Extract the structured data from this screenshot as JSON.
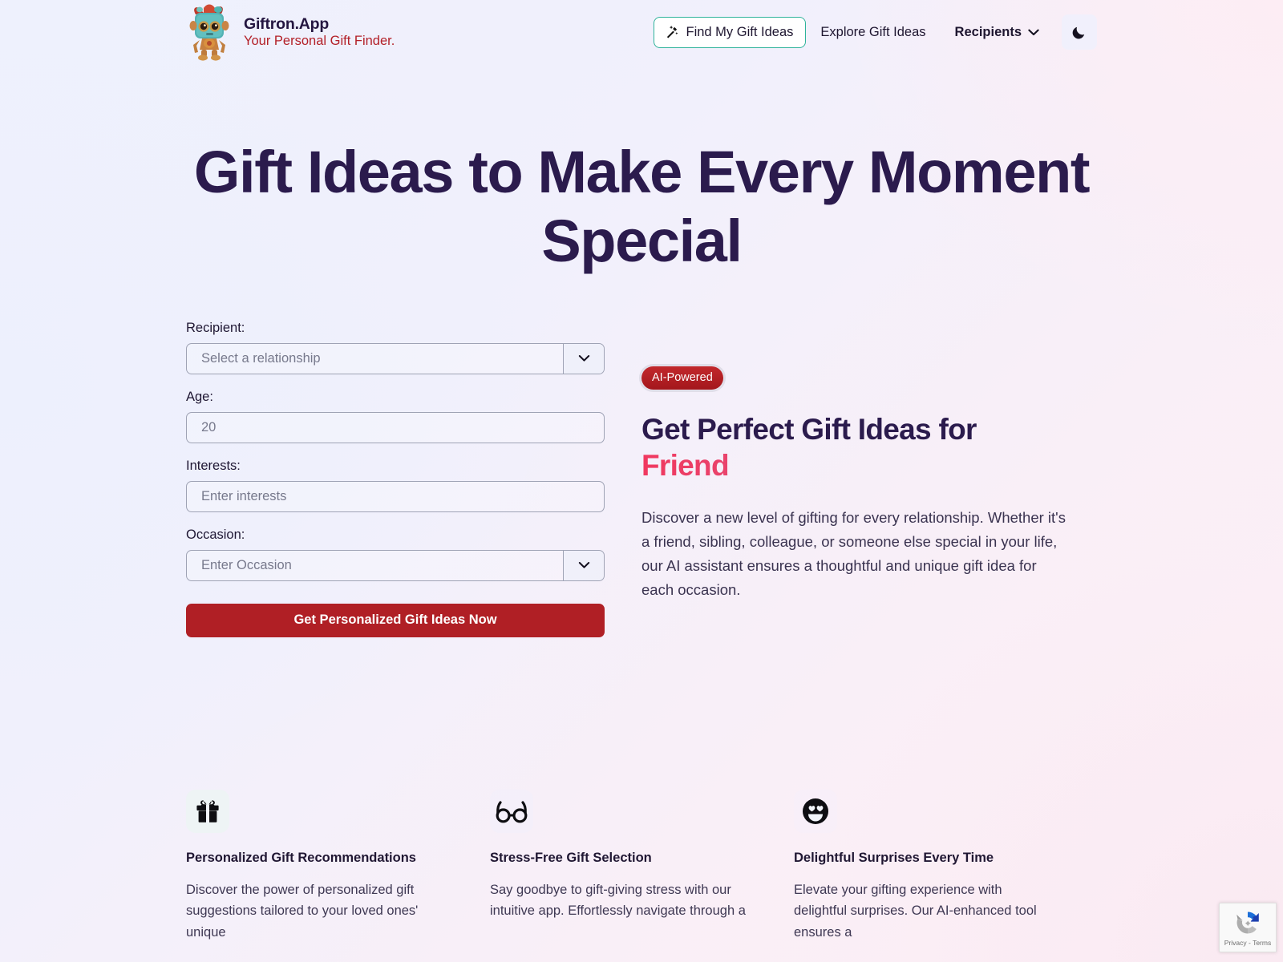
{
  "brand": {
    "logo_icon": "robot-gift-logo",
    "name": "Giftron.App",
    "tagline": "Your Personal Gift Finder."
  },
  "nav": {
    "cta": {
      "label": "Find My Gift Ideas",
      "icon": "magic-wand-icon",
      "border_color": "#2FB39B"
    },
    "links": [
      {
        "label": "Explore Gift Ideas"
      }
    ],
    "dropdown": {
      "label": "Recipients",
      "icon": "chevron-down-icon"
    },
    "theme_toggle": {
      "icon": "moon-icon",
      "label": "Dark mode"
    }
  },
  "hero": {
    "title": "Gift Ideas to Make Every Moment Special"
  },
  "form": {
    "fields": [
      {
        "label": "Recipient:",
        "placeholder": "Select a relationship",
        "value": "",
        "type": "select",
        "name": "recipient"
      },
      {
        "label": "Age:",
        "placeholder": "20",
        "value": "",
        "type": "text",
        "name": "age"
      },
      {
        "label": "Interests:",
        "placeholder": "Enter interests",
        "value": "",
        "type": "text",
        "name": "interests"
      },
      {
        "label": "Occasion:",
        "placeholder": "Enter Occasion",
        "value": "",
        "type": "select",
        "name": "occasion"
      }
    ],
    "submit_label": "Get Personalized Gift Ideas Now",
    "submit_color": "#B01F25"
  },
  "promo": {
    "badge": "AI-Powered",
    "title_line1": "Get Perfect Gift Ideas for",
    "title_highlight": "Friend",
    "highlight_gradient": [
      "#F0385F",
      "#A96AC6"
    ],
    "description": "Discover a new level of gifting for every relationship. Whether it's a friend, sibling, colleague, or someone else special in your life, our AI assistant ensures a thoughtful and unique gift idea for each occasion."
  },
  "features": [
    {
      "icon": "gift-box-icon",
      "title": "Personalized Gift Recommendations",
      "description": "Discover the power of personalized gift suggestions tailored to your loved ones' unique"
    },
    {
      "icon": "glasses-icon",
      "title": "Stress-Free Gift Selection",
      "description": "Say goodbye to gift-giving stress with our intuitive app. Effortlessly navigate through a"
    },
    {
      "icon": "smiling-face-icon",
      "title": "Delightful Surprises Every Time",
      "description": "Elevate your gifting experience with delightful surprises. Our AI-enhanced tool ensures a"
    }
  ],
  "recaptcha": {
    "icon": "recaptcha-icon",
    "terms": "Privacy - Terms"
  }
}
